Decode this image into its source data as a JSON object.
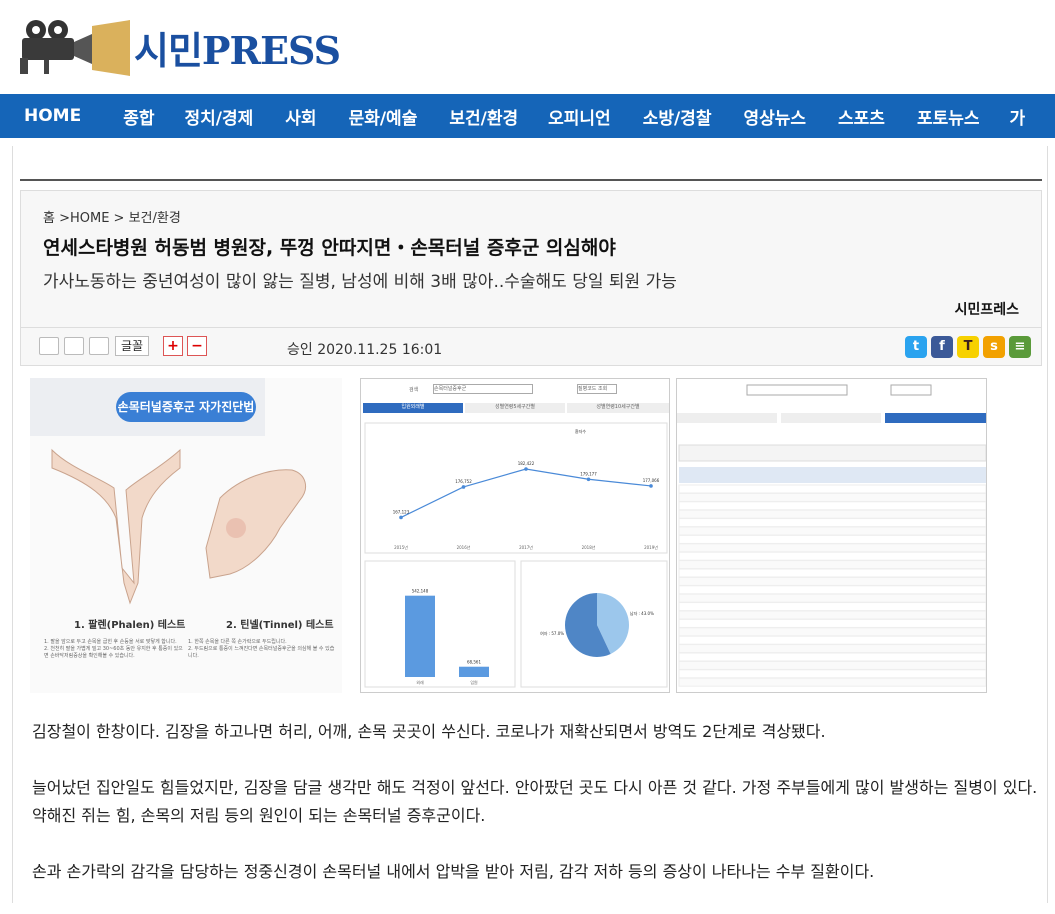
{
  "site": {
    "logo_text": "시민PRESS"
  },
  "nav": [
    "HOME",
    "종합",
    "정치/경제",
    "사회",
    "문화/예술",
    "보건/환경",
    "오피니언",
    "소방/경찰",
    "영상뉴스",
    "스포츠",
    "포토뉴스",
    "가"
  ],
  "article": {
    "breadcrumb": "홈 >HOME > 보건/환경",
    "title": "연세스타병원 허동범 병원장, 뚜껑 안따지면・손목터널 증후군 의심해야",
    "subtitle": "가사노동하는 중년여성이 많이 앓는 질병, 남성에 비해 3배 많아..수술해도 당일 퇴원 가능",
    "author": "시민프레스",
    "date": "승인 2020.11.25 16:01",
    "font_button": "글꼴",
    "plus": "+",
    "minus": "−"
  },
  "infographic": {
    "banner": "손목터널증후군 자가진단법",
    "test1_title": "1. 팔렌(Phalen) 테스트",
    "test1_desc": "1. 팔을 앞으로 두고 손목을 굽힌 후 손등을 서로 맞닿게 합니다.\n2. 천천히 팔을 가볍게 밀고 30~60초 동안 유지한 후 통증이 있으면 손바닥저림증상을 확인해볼 수 있습니다.",
    "test2_title": "2. 틴넬(Tinnel) 테스트",
    "test2_desc": "1. 한쪽 손목을 다른 쪽 손가락으로 두드립니다.\n2. 두드림으로 통증이 느껴진다면 손목터널증후군을 의심해 볼 수 있습니다."
  },
  "stats_panel": {
    "search_label": "검색",
    "search_value": "손목터널증후군",
    "search_button": "질병코드 조회",
    "tabs": [
      "입원외래별",
      "성별연령5세구간별",
      "성별연령10세구간별"
    ],
    "line_chart": {
      "x": [
        "2015년",
        "2016년",
        "2017년",
        "2018년",
        "2019년"
      ],
      "values": [
        167123,
        176752,
        182422,
        179177,
        177066
      ],
      "legend": "환자수"
    },
    "bar_chart": {
      "categories": [
        "외래",
        "입원"
      ],
      "values": [
        542148,
        68561
      ]
    },
    "pie_chart": {
      "slices": [
        {
          "label": "남자",
          "value": 43.0
        },
        {
          "label": "여자",
          "value": 57.0
        }
      ]
    }
  },
  "colors": {
    "brand": "#1565b8",
    "logo": "#1a4fa0",
    "banner": "#3a7fd5"
  },
  "body": [
    "김장철이 한창이다. 김장을 하고나면 허리, 어깨, 손목 곳곳이 쑤신다. 코로나가 재확산되면서 방역도 2단계로 격상됐다.",
    "늘어났던 집안일도 힘들었지만, 김장을 담글 생각만 해도 걱정이 앞선다. 안아팠던 곳도 다시 아픈 것 같다. 가정 주부들에게 많이 발생하는 질병이 있다. 약해진 쥐는 힘, 손목의 저림 등의 원인이 되는 손목터널 증후군이다.",
    "손과 손가락의 감각을 담당하는 정중신경이 손목터널 내에서 압박을 받아 저림, 감각 저하 등의 증상이 나타나는 수부 질환이다."
  ]
}
